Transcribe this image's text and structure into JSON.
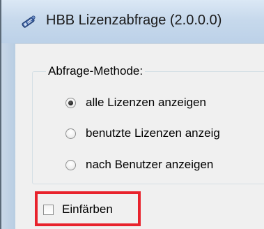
{
  "window": {
    "title": "HBB Lizenzabfrage (2.0.0.0)",
    "icon": "key-license-icon"
  },
  "query_method": {
    "legend": "Abfrage-Methode:",
    "options": [
      {
        "label": "alle Lizenzen anzeigen",
        "checked": true
      },
      {
        "label": "benutzte Lizenzen anzeig",
        "checked": false
      },
      {
        "label": "nach Benutzer anzeigen",
        "checked": false
      }
    ]
  },
  "colorize": {
    "label": "Einfärben",
    "checked": false,
    "highlight_color": "#e8222c"
  }
}
